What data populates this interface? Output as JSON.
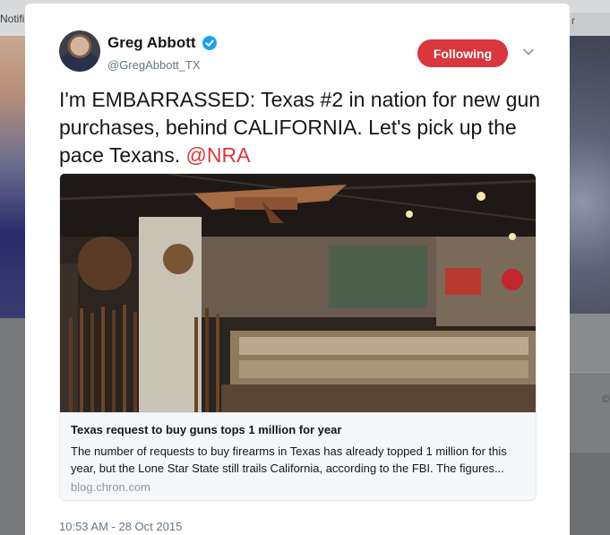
{
  "background": {
    "topbar_label": "Notifi",
    "topbar_right_label": "r",
    "right_card_label": "©"
  },
  "tweet": {
    "author_name": "Greg Abbott",
    "author_handle": "@GregAbbott_TX",
    "verified": true,
    "follow_label": "Following",
    "text_main": "I'm EMBARRASSED: Texas #2 in nation for new gun purchases, behind CALIFORNIA. Let's pick up the pace Texans. ",
    "mention": "@NRA",
    "timestamp": "10:53 AM - 28 Oct 2015"
  },
  "card": {
    "title": "Texas request to buy guns tops 1 million for year",
    "description": "The number of requests to buy firearms in Texas has already topped 1 million for this year, but the Lone Star State still trails California, according to the FBI. The figures...",
    "domain": "blog.chron.com"
  },
  "colors": {
    "follow_button": "#d9363e",
    "mention": "#d9363e",
    "verified": "#1da1f2"
  }
}
